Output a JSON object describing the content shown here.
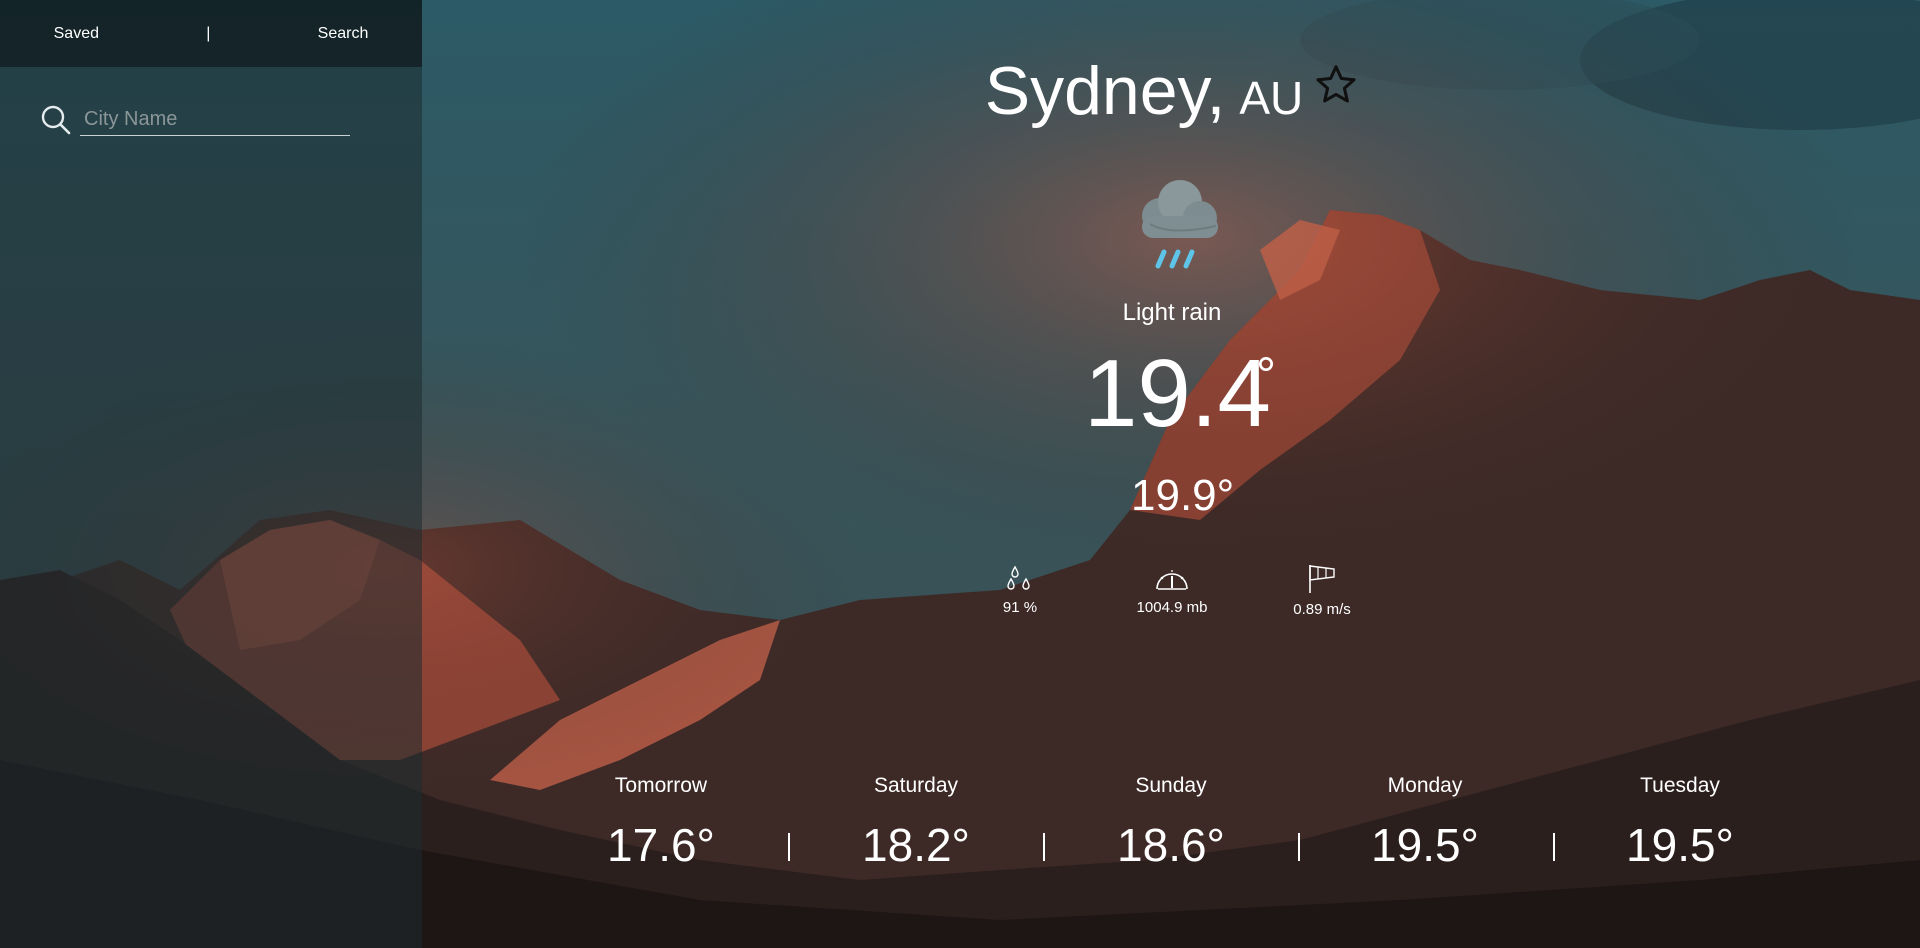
{
  "sidebar": {
    "tabs": [
      {
        "label": "Saved"
      },
      {
        "label": "Search"
      }
    ],
    "separator": "|",
    "search": {
      "placeholder": "City Name",
      "value": ""
    }
  },
  "location": {
    "city": "Sydney,",
    "country": "AU"
  },
  "current": {
    "condition": "Light rain",
    "icon": "rain-cloud-icon",
    "temperature": "19.4",
    "degree": "°",
    "feels_like": "19.9°",
    "humidity": "91 %",
    "pressure": "1004.9 mb",
    "wind": "0.89 m/s"
  },
  "forecast": [
    {
      "day": "Tomorrow",
      "temp": "17.6°"
    },
    {
      "day": "Saturday",
      "temp": "18.2°"
    },
    {
      "day": "Sunday",
      "temp": "18.6°"
    },
    {
      "day": "Monday",
      "temp": "19.5°"
    },
    {
      "day": "Tuesday",
      "temp": "19.5°"
    }
  ],
  "colors": {
    "sky_top": "#2f5c68",
    "sky_bottom": "#3a4d51",
    "mountain_lit": "#c9634a",
    "mountain_dark": "#2a1d1b",
    "raindrop": "#5ec4e8",
    "cloud": "#7d8c90"
  }
}
